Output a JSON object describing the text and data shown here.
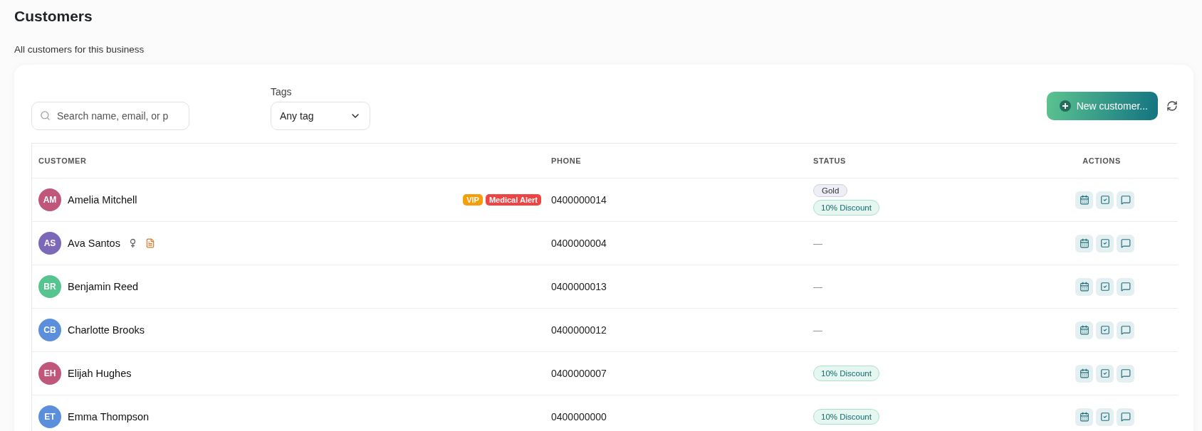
{
  "page": {
    "title": "Customers",
    "subtitle": "All customers for this business"
  },
  "toolbar": {
    "search": {
      "placeholder": "Search name, email, or p"
    },
    "tags_filter": {
      "label": "Tags",
      "value": "Any tag"
    },
    "new_button": "New customer..."
  },
  "table": {
    "columns": [
      "CUSTOMER",
      "PHONE",
      "STATUS",
      "ACTIONS"
    ],
    "rows": [
      {
        "initials": "AM",
        "color": "#c0577a",
        "name": "Amelia Mitchell",
        "indicators": [],
        "tags": [
          {
            "label": "VIP",
            "color": "#f59e0b"
          },
          {
            "label": "Medical Alert",
            "color": "#ef4444"
          }
        ],
        "phone": "0400000014",
        "status": [
          {
            "kind": "tier",
            "label": "Gold"
          },
          {
            "kind": "discount",
            "label": "10% Discount"
          }
        ]
      },
      {
        "initials": "AS",
        "color": "#7b68b8",
        "name": "Ava Santos",
        "indicators": [
          {
            "kind": "gender"
          },
          {
            "kind": "note"
          }
        ],
        "tags": [],
        "phone": "0400000004",
        "status": [
          {
            "kind": "none",
            "label": "—"
          }
        ]
      },
      {
        "initials": "BR",
        "color": "#55c48f",
        "name": "Benjamin Reed",
        "indicators": [],
        "tags": [],
        "phone": "0400000013",
        "status": [
          {
            "kind": "none",
            "label": "—"
          }
        ]
      },
      {
        "initials": "CB",
        "color": "#5b8fdc",
        "name": "Charlotte Brooks",
        "indicators": [],
        "tags": [],
        "phone": "0400000012",
        "status": [
          {
            "kind": "none",
            "label": "—"
          }
        ]
      },
      {
        "initials": "EH",
        "color": "#c0577a",
        "name": "Elijah Hughes",
        "indicators": [],
        "tags": [],
        "phone": "0400000007",
        "status": [
          {
            "kind": "discount",
            "label": "10% Discount"
          }
        ]
      },
      {
        "initials": "ET",
        "color": "#5b8fdc",
        "name": "Emma Thompson",
        "indicators": [],
        "tags": [],
        "phone": "0400000000",
        "status": [
          {
            "kind": "discount",
            "label": "10% Discount"
          }
        ]
      }
    ]
  }
}
